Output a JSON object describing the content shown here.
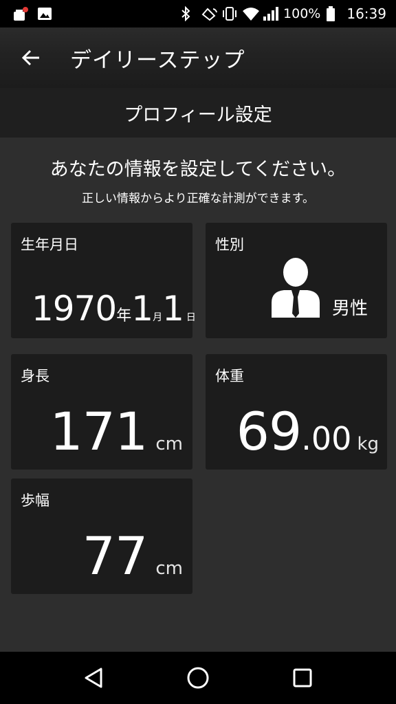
{
  "status_bar": {
    "battery_percent": "100%",
    "time": "16:39",
    "icons": [
      "notification-app-icon",
      "gallery-icon",
      "bluetooth-icon",
      "nfc-icon",
      "vibrate-icon",
      "wifi-icon",
      "signal-icon",
      "battery-icon"
    ]
  },
  "app_bar": {
    "title": "デイリーステップ",
    "back_icon": "arrow-left-icon"
  },
  "sub_header": {
    "title": "プロフィール設定"
  },
  "intro": {
    "title": "あなたの情報を設定してください。",
    "subtitle": "正しい情報からより正確な計測ができます。"
  },
  "cards": {
    "birthday": {
      "label": "生年月日",
      "year": "1970",
      "year_unit": "年",
      "month": "1",
      "month_unit": "月",
      "day": "1",
      "day_unit": "日"
    },
    "gender": {
      "label": "性別",
      "value": "男性",
      "icon": "male-person-icon"
    },
    "height": {
      "label": "身長",
      "value": "171",
      "unit": "cm"
    },
    "weight": {
      "label": "体重",
      "integer": "69",
      "decimal": ".00",
      "unit": "kg"
    },
    "stride": {
      "label": "歩幅",
      "value": "77",
      "unit": "cm"
    }
  },
  "nav_bar": {
    "icons": [
      "back-triangle-icon",
      "home-circle-icon",
      "recents-square-icon"
    ]
  },
  "colors": {
    "background": "#2e2e2e",
    "card": "#1c1c1c",
    "header": "#1f1f1f",
    "text": "#ffffff"
  }
}
